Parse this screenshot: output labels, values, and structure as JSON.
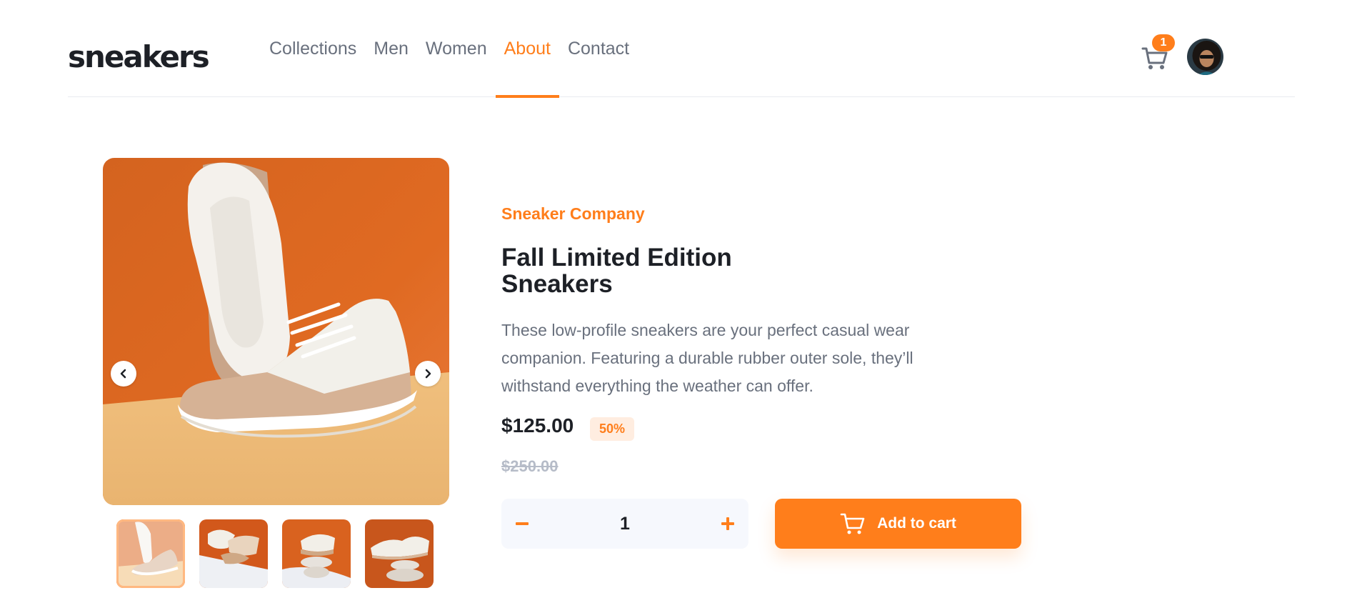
{
  "brand": {
    "logo": "sneakers"
  },
  "nav": {
    "items": [
      {
        "label": "Collections"
      },
      {
        "label": "Men"
      },
      {
        "label": "Women"
      },
      {
        "label": "About"
      },
      {
        "label": "Contact"
      }
    ],
    "active": "About"
  },
  "cart": {
    "count": "1",
    "icon": "cart-icon"
  },
  "user": {
    "avatar_icon": "user-avatar"
  },
  "gallery": {
    "prev_icon": "chevron-left-icon",
    "next_icon": "chevron-right-icon",
    "thumbnail_count": 4,
    "active_thumbnail": 1
  },
  "product": {
    "company": "Sneaker Company",
    "title_line1": "Fall Limited Edition",
    "title_line2": "Sneakers",
    "description": "These low-profile sneakers are your perfect casual wear companion. Featuring a durable rubber outer sole, they’ll withstand everything the weather can offer.",
    "price": "$125.00",
    "discount": "50%",
    "original_price": "$250.00"
  },
  "quantity": {
    "minus_label": "−",
    "value": "1",
    "plus_label": "+"
  },
  "add_to_cart": {
    "label": "Add to cart",
    "icon": "cart-icon"
  },
  "colors": {
    "accent": "#ff7e1b",
    "text_dark": "#1d2026",
    "text_muted": "#69707d",
    "pale_orange": "#ffede0",
    "light_bg": "#f6f8fd"
  }
}
